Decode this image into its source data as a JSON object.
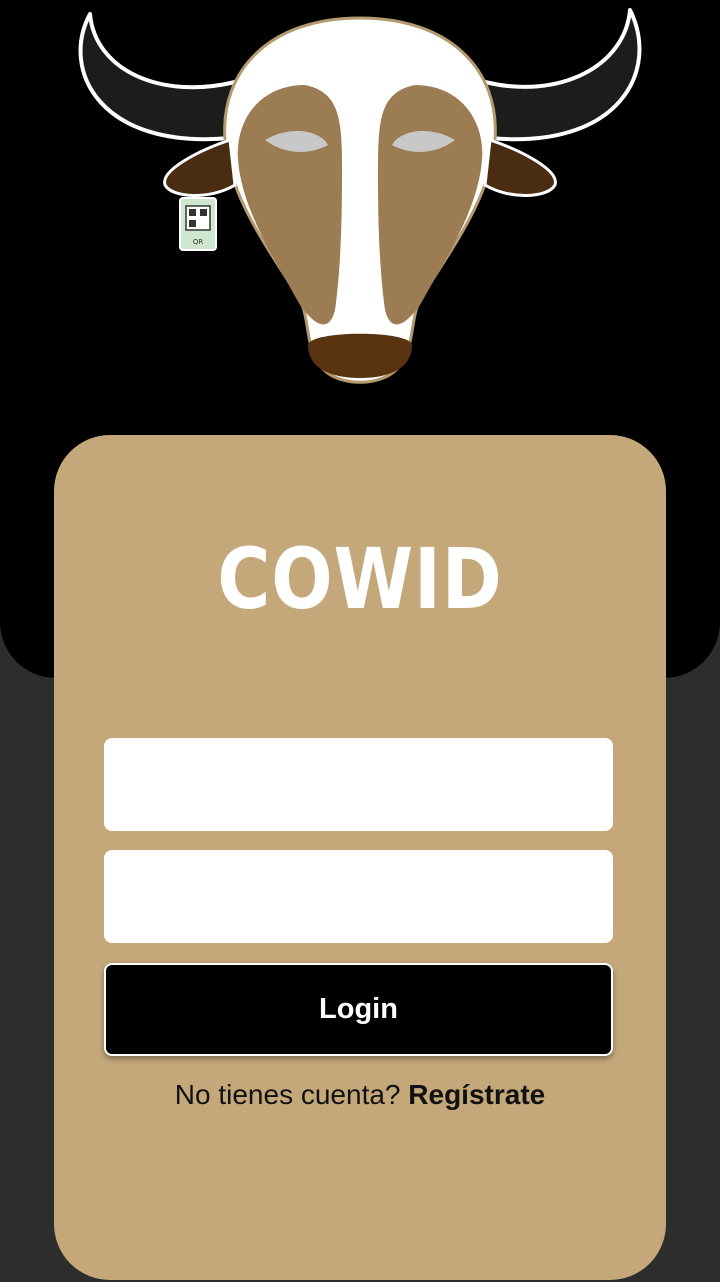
{
  "app": {
    "title": "COWID"
  },
  "logo": {
    "icon": "cow-head-icon",
    "ear_tag_text": "QR"
  },
  "login_form": {
    "username": {
      "value": "",
      "placeholder": ""
    },
    "password": {
      "value": "",
      "placeholder": ""
    },
    "login_label": "Login"
  },
  "register": {
    "prompt": "No tienes cuenta? ",
    "link_label": "Regístrate"
  },
  "colors": {
    "header_bg": "#000000",
    "page_bg": "#2d2d2d",
    "card_bg": "#c4a87a",
    "button_bg": "#000000",
    "title_text": "#ffffff"
  }
}
